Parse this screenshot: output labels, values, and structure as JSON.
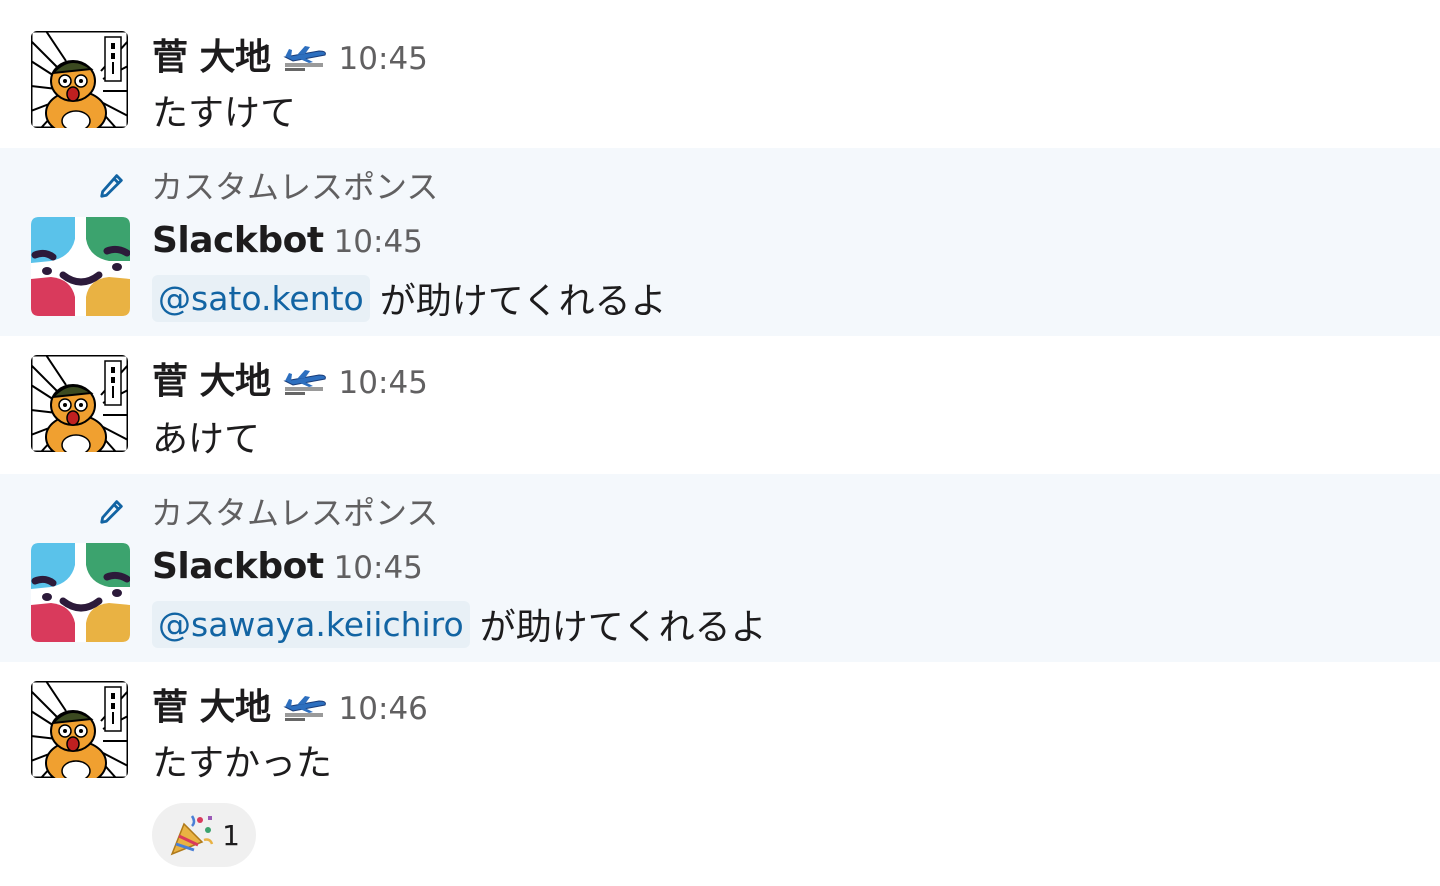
{
  "messages": [
    {
      "user": "菅 大地",
      "status_icon": "airplane-icon",
      "time": "10:45",
      "text": "たすけて"
    },
    {
      "label": "カスタムレスポンス",
      "label_icon": "pencil-icon",
      "user": "Slackbot",
      "time": "10:45",
      "mention": "@sato.kento",
      "text": "が助けてくれるよ"
    },
    {
      "user": "菅 大地",
      "status_icon": "airplane-icon",
      "time": "10:45",
      "text": "あけて"
    },
    {
      "label": "カスタムレスポンス",
      "label_icon": "pencil-icon",
      "user": "Slackbot",
      "time": "10:45",
      "mention": "@sawaya.keiichiro",
      "text": "が助けてくれるよ"
    },
    {
      "user": "菅 大地",
      "status_icon": "airplane-icon",
      "time": "10:46",
      "text": "たすかった",
      "reaction": {
        "emoji": "party-popper-icon",
        "count": "1"
      }
    }
  ],
  "colors": {
    "bot_row_bg": "#f4f8fc",
    "mention_bg": "#e8f0f6",
    "mention_text": "#1264a3",
    "pencil": "#1264a3",
    "timestamp": "#616061"
  }
}
